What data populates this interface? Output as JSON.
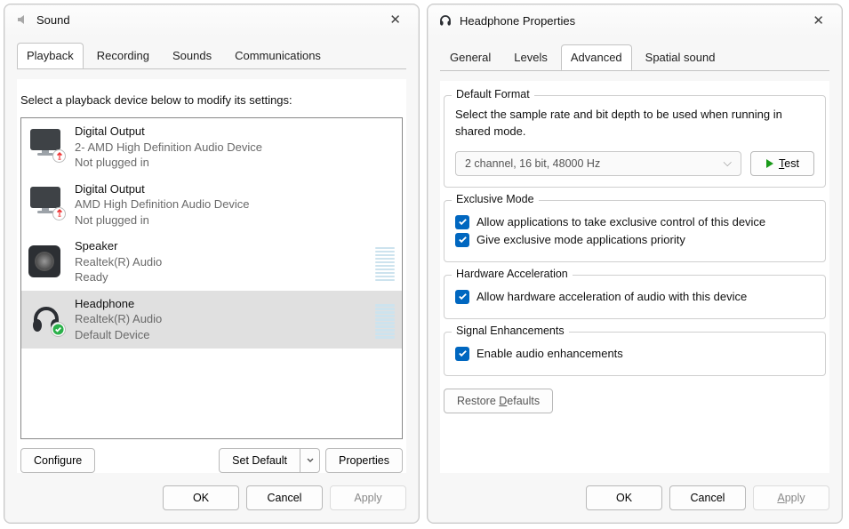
{
  "sound_window": {
    "title": "Sound",
    "tabs": [
      "Playback",
      "Recording",
      "Sounds",
      "Communications"
    ],
    "active_tab_index": 0,
    "description": "Select a playback device below to modify its settings:",
    "devices": [
      {
        "name": "Digital Output",
        "line2": "2- AMD High Definition Audio Device",
        "line3": "Not plugged in",
        "icon": "monitor-unplugged",
        "selected": false,
        "has_vu": false
      },
      {
        "name": "Digital Output",
        "line2": "AMD High Definition Audio Device",
        "line3": "Not plugged in",
        "icon": "monitor-unplugged",
        "selected": false,
        "has_vu": false
      },
      {
        "name": "Speaker",
        "line2": "Realtek(R) Audio",
        "line3": "Ready",
        "icon": "speaker",
        "selected": false,
        "has_vu": true
      },
      {
        "name": "Headphone",
        "line2": "Realtek(R) Audio",
        "line3": "Default Device",
        "icon": "headphone-default",
        "selected": true,
        "has_vu": true
      }
    ],
    "buttons": {
      "configure": "Configure",
      "set_default": "Set Default",
      "properties": "Properties"
    },
    "footer": {
      "ok": "OK",
      "cancel": "Cancel",
      "apply": "Apply"
    }
  },
  "properties_window": {
    "title": "Headphone Properties",
    "tabs": [
      "General",
      "Levels",
      "Advanced",
      "Spatial sound"
    ],
    "active_tab_index": 2,
    "default_format": {
      "legend": "Default Format",
      "desc": "Select the sample rate and bit depth to be used when running in shared mode.",
      "selected": "2 channel, 16 bit, 48000 Hz",
      "test_label": "Test"
    },
    "exclusive_mode": {
      "legend": "Exclusive Mode",
      "check1": "Allow applications to take exclusive control of this device",
      "check2": "Give exclusive mode applications priority"
    },
    "hw_accel": {
      "legend": "Hardware Acceleration",
      "check1": "Allow hardware acceleration of audio with this device"
    },
    "signal_enh": {
      "legend": "Signal Enhancements",
      "check1": "Enable audio enhancements"
    },
    "restore_defaults": "Restore Defaults",
    "footer": {
      "ok": "OK",
      "cancel": "Cancel",
      "apply": "Apply"
    }
  }
}
